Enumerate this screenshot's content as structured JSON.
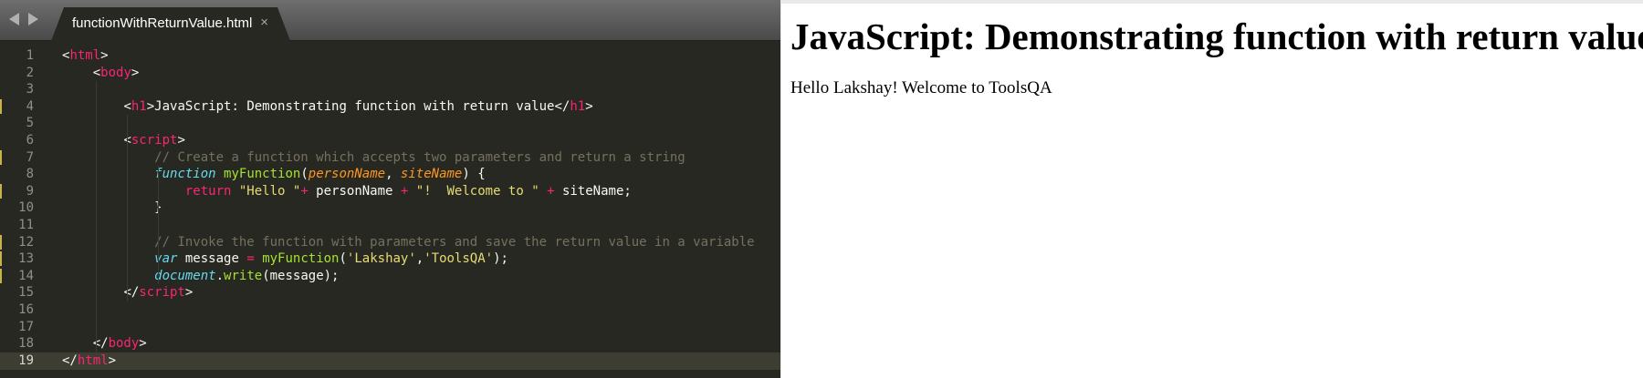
{
  "editor": {
    "tab_title": "functionWithReturnValue.html",
    "close_glyph": "×",
    "active_line": 19,
    "modified_lines": [
      4,
      7,
      9,
      12,
      13,
      14
    ],
    "lines": [
      [
        [
          "tag",
          "<"
        ],
        [
          "tk",
          "html"
        ],
        [
          "tag2",
          ">"
        ]
      ],
      [
        [
          "indent",
          "    "
        ],
        [
          "tag",
          "<"
        ],
        [
          "tk",
          "body"
        ],
        [
          "tag2",
          ">"
        ]
      ],
      [],
      [
        [
          "indent",
          "        "
        ],
        [
          "tag",
          "<"
        ],
        [
          "tk",
          "h1"
        ],
        [
          "tag2",
          ">"
        ],
        [
          "plain",
          "JavaScript: Demonstrating function with return value</"
        ],
        [
          "tk",
          "h1"
        ],
        [
          "tag2",
          ">"
        ]
      ],
      [],
      [
        [
          "indent",
          "        "
        ],
        [
          "tag",
          "<"
        ],
        [
          "tk",
          "script"
        ],
        [
          "tag2",
          ">"
        ]
      ],
      [
        [
          "indent",
          "            "
        ],
        [
          "comment",
          "// Create a function which accepts two parameters and return a string"
        ]
      ],
      [
        [
          "indent",
          "            "
        ],
        [
          "keyword",
          "function"
        ],
        [
          "plain",
          " "
        ],
        [
          "func",
          "myFunction"
        ],
        [
          "plain",
          "("
        ],
        [
          "param",
          "personName"
        ],
        [
          "plain",
          ", "
        ],
        [
          "param",
          "siteName"
        ],
        [
          "plain",
          ") {"
        ]
      ],
      [
        [
          "indent",
          "                "
        ],
        [
          "op",
          "return"
        ],
        [
          "plain",
          " "
        ],
        [
          "string",
          "\"Hello \""
        ],
        [
          "op",
          "+"
        ],
        [
          "plain",
          " personName "
        ],
        [
          "op",
          "+"
        ],
        [
          "plain",
          " "
        ],
        [
          "string",
          "\"!  Welcome to \""
        ],
        [
          "plain",
          " "
        ],
        [
          "op",
          "+"
        ],
        [
          "plain",
          " siteName;"
        ]
      ],
      [
        [
          "indent",
          "            "
        ],
        [
          "plain",
          "}"
        ]
      ],
      [],
      [
        [
          "indent",
          "            "
        ],
        [
          "comment",
          "// Invoke the function with parameters and save the return value in a variable"
        ]
      ],
      [
        [
          "indent",
          "            "
        ],
        [
          "keyword",
          "var"
        ],
        [
          "plain",
          " message "
        ],
        [
          "op",
          "="
        ],
        [
          "plain",
          " "
        ],
        [
          "func",
          "myFunction"
        ],
        [
          "plain",
          "("
        ],
        [
          "string",
          "'Lakshay'"
        ],
        [
          "plain",
          ","
        ],
        [
          "string",
          "'ToolsQA'"
        ],
        [
          "plain",
          ");"
        ]
      ],
      [
        [
          "indent",
          "            "
        ],
        [
          "keyword",
          "document"
        ],
        [
          "plain",
          "."
        ],
        [
          "func",
          "write"
        ],
        [
          "plain",
          "(message);"
        ]
      ],
      [
        [
          "indent",
          "        "
        ],
        [
          "tag",
          "</"
        ],
        [
          "tk",
          "script"
        ],
        [
          "tag2",
          ">"
        ]
      ],
      [],
      [],
      [
        [
          "indent",
          "    "
        ],
        [
          "tag",
          "</"
        ],
        [
          "tk",
          "body"
        ],
        [
          "tag2",
          ">"
        ]
      ],
      [
        [
          "tag",
          "</"
        ],
        [
          "tk",
          "html"
        ],
        [
          "tag2",
          ">"
        ]
      ]
    ]
  },
  "browser": {
    "heading": "JavaScript: Demonstrating function with return value",
    "output": "Hello Lakshay! Welcome to ToolsQA"
  }
}
